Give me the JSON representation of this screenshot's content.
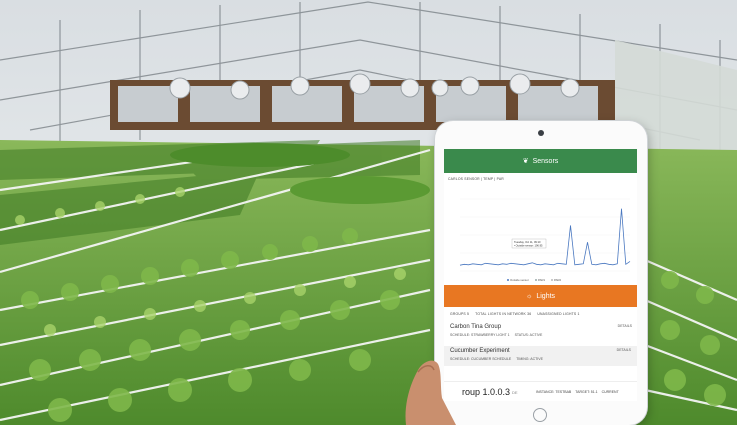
{
  "tablet": {
    "sensors_title": "Sensors",
    "sensors_tabs": "CARLOS SENSOR | TEMP | PAR",
    "lights_title": "Lights",
    "lights_tabs": [
      "GROUPS 5",
      "TOTAL LIGHTS IN NETWORK 36",
      "UNASSIGNED LIGHTS 1"
    ],
    "chart_tooltip_line1": "Tuesday, Oct 11, 09:10",
    "chart_tooltip_line2": "• Outside sensor: 196.95",
    "chart_legend": [
      "Outside sensor",
      "PAR1",
      "PAR2"
    ],
    "groups": [
      {
        "name": "Carbon Tina Group",
        "details_label": "DETAILS",
        "schedule": "SCHEDULE: STRAWBERRY LIGHT 1",
        "status": "STATUS: ACTIVE"
      },
      {
        "name": "Cucumber Experiment",
        "details_label": "DETAILS",
        "schedule": "SCHEDULE: CUCUMBER SCHEDULE",
        "status": "TIMING: ACTIVE"
      }
    ],
    "bottom_group": "roup 1.0.0.3",
    "bottom_sep": "DE",
    "bottom_meta": [
      "INSTANCE: TESTBAB",
      "TARGET: 51.1",
      "CURRENT"
    ]
  },
  "colors": {
    "sensors_bar": "#3a8a4c",
    "lights_bar": "#e87722",
    "chart_line": "#4a78c0",
    "plants": "#5f9e3a"
  },
  "chart_data": {
    "type": "line",
    "series": [
      {
        "name": "Outside sensor",
        "values": [
          12,
          14,
          13,
          15,
          14,
          13,
          16,
          15,
          14,
          13,
          15,
          14,
          16,
          15,
          14,
          13,
          15,
          17,
          14,
          13,
          15,
          14,
          13,
          16,
          15,
          14,
          95,
          13,
          14,
          15,
          60,
          14,
          13,
          15,
          16,
          14,
          13,
          15,
          130,
          14,
          20
        ]
      }
    ],
    "ylim": [
      0,
      150
    ]
  }
}
